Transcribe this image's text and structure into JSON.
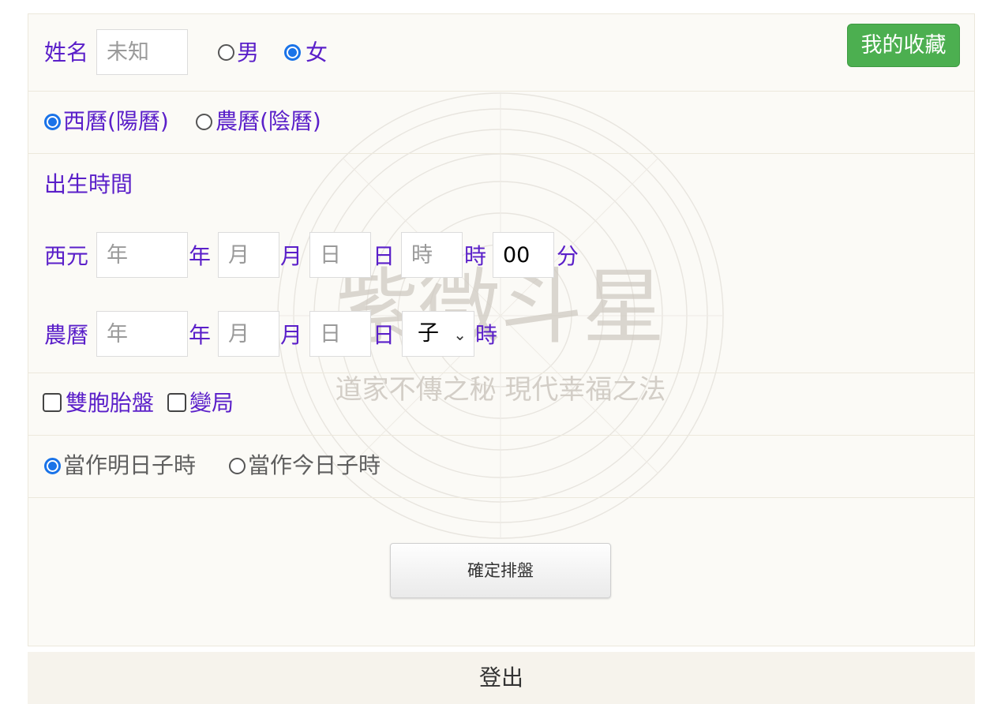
{
  "form": {
    "name_label": "姓名",
    "name_placeholder": "未知",
    "gender": {
      "male": "男",
      "female": "女",
      "selected": "female"
    },
    "favorites_button": "我的收藏",
    "calendar": {
      "solar": "西曆(陽曆)",
      "lunar": "農曆(陰曆)",
      "selected": "solar"
    },
    "birth_time_title": "出生時間",
    "solar_row": {
      "label": "西元",
      "year_placeholder": "年",
      "year_unit": "年",
      "month_placeholder": "月",
      "month_unit": "月",
      "day_placeholder": "日",
      "day_unit": "日",
      "hour_placeholder": "時",
      "hour_unit": "時",
      "minute_value": "00",
      "minute_unit": "分"
    },
    "lunar_row": {
      "label": "農曆",
      "year_placeholder": "年",
      "year_unit": "年",
      "month_placeholder": "月",
      "month_unit": "月",
      "day_placeholder": "日",
      "day_unit": "日",
      "hour_select_value": "子",
      "hour_unit": "時"
    },
    "options": {
      "twin": "雙胞胎盤",
      "variant": "變局"
    },
    "zi_hour": {
      "tomorrow": "當作明日子時",
      "today": "當作今日子時",
      "selected": "tomorrow"
    },
    "submit_button": "確定排盤"
  },
  "watermark": {
    "title": "紫微斗星",
    "slogan": "道家不傳之秘 現代幸福之法"
  },
  "logout_label": "登出"
}
